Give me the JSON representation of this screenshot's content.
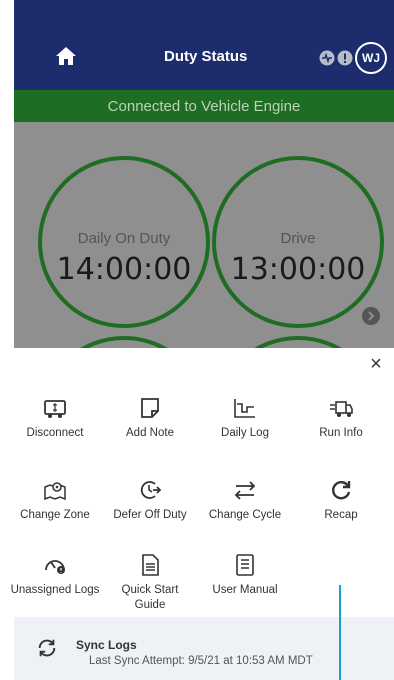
{
  "header": {
    "title": "Duty Status",
    "avatar_initials": "WJ",
    "background": "#1c2c6d"
  },
  "banner": {
    "text": "Connected to Vehicle Engine",
    "background": "#1f6d22"
  },
  "dials": [
    {
      "label": "Daily On Duty",
      "value": "14:00:00"
    },
    {
      "label": "Drive",
      "value": "13:00:00"
    }
  ],
  "menu": {
    "close_label": "×",
    "items": [
      {
        "label": "Disconnect",
        "icon": "truck-disconnect-icon"
      },
      {
        "label": "Add Note",
        "icon": "note-icon"
      },
      {
        "label": "Daily Log",
        "icon": "daily-log-icon"
      },
      {
        "label": "Run Info",
        "icon": "run-info-truck-icon"
      },
      {
        "label": "Change Zone",
        "icon": "map-pin-icon"
      },
      {
        "label": "Defer Off Duty",
        "icon": "clock-arrow-icon"
      },
      {
        "label": "Change Cycle",
        "icon": "swap-arrows-icon"
      },
      {
        "label": "Recap",
        "icon": "refresh-icon"
      },
      {
        "label": "Unassigned Logs",
        "icon": "gauge-icon"
      },
      {
        "label": "Quick Start Guide",
        "icon": "document-icon"
      },
      {
        "label": "User Manual",
        "icon": "manual-icon"
      }
    ]
  },
  "sync": {
    "title": "Sync Logs",
    "subtitle": "Last Sync Attempt: 9/5/21 at 10:53 AM MDT"
  }
}
